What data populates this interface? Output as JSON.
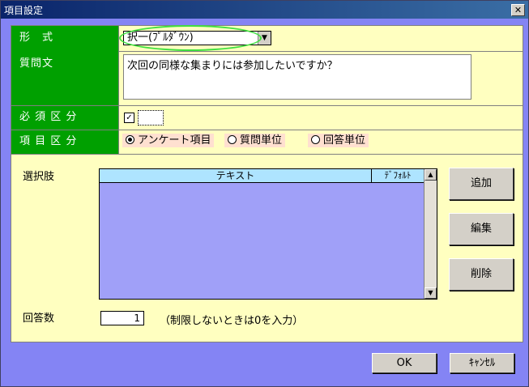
{
  "window": {
    "title": "項目設定",
    "close_glyph": "✕"
  },
  "form": {
    "format_label": "形　式",
    "format_value": "択一(ﾌﾟﾙﾀﾞｳﾝ)",
    "question_label": "質問文",
    "question_value": "次回の同様な集まりには参加したいですか？",
    "required_label": "必 須 区 分",
    "required_checked": true,
    "category_label": "項 目 区 分",
    "category_options": [
      {
        "label": "アンケート項目",
        "selected": true
      },
      {
        "label": "質問単位",
        "selected": false
      },
      {
        "label": "回答単位",
        "selected": false
      }
    ]
  },
  "choices": {
    "label": "選択肢",
    "columns": [
      "テキスト",
      "ﾃﾞﾌｫﾙﾄ"
    ],
    "rows": []
  },
  "side_buttons": {
    "add": "追加",
    "edit": "編集",
    "delete": "削除"
  },
  "answers": {
    "label": "回答数",
    "value": "1",
    "note": "（制限しないときは0を入力）"
  },
  "footer": {
    "ok": "OK",
    "cancel": "ｷｬﾝｾﾙ"
  }
}
